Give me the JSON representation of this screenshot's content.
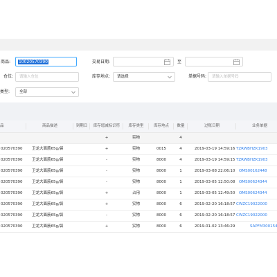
{
  "filters": {
    "product": {
      "label": "商品:",
      "value": "10020570390"
    },
    "txn_date": {
      "label": "交易日期:",
      "separator": "至",
      "start_icon": "calendar-icon",
      "end_icon": "calendar-icon"
    },
    "location": {
      "label": "仓位:",
      "placeholder": "请输入仓位"
    },
    "warehouse": {
      "label": "库存地点:",
      "placeholder": "请选择",
      "icon": "chevron-down-icon"
    },
    "doc_no": {
      "label": "单据号码:",
      "placeholder": "请输入单据号码"
    },
    "type": {
      "label": "类型:",
      "value": "全部",
      "icon": "chevron-down-icon"
    }
  },
  "table": {
    "columns": [
      "品",
      "商品描述",
      "到期日",
      "库存增减标识符",
      "库存类型",
      "库存地点",
      "数量",
      "过账日期",
      "业务单据"
    ],
    "subtotal": {
      "sign": "+",
      "type": "实物",
      "qty": "4"
    },
    "rows": [
      {
        "sku": "020570390",
        "desc": "卫龙大面筋65g/袋",
        "expiry": "",
        "sign": "+",
        "type": "实物",
        "location": "0015",
        "qty": "4",
        "date": "2019-03-19 14:59:16",
        "doc": "TZRWBHZK1903"
      },
      {
        "sku": "020570390",
        "desc": "卫龙大面筋65g/袋",
        "expiry": "",
        "sign": "-",
        "type": "实物",
        "location": "8000",
        "qty": "4",
        "date": "2019-03-19 14:59:15",
        "doc": "TZRWBHZK1903"
      },
      {
        "sku": "020570390",
        "desc": "卫龙大面筋65g/袋",
        "expiry": "",
        "sign": "-",
        "type": "实物",
        "location": "8000",
        "qty": "1",
        "date": "2019-03-08 22:06:10",
        "doc": "OMS00162448"
      },
      {
        "sku": "020570390",
        "desc": "卫龙大面筋65g/袋",
        "expiry": "",
        "sign": "-",
        "type": "实物",
        "location": "8000",
        "qty": "1",
        "date": "2019-03-05 12:50:08",
        "doc": "OMS00624344"
      },
      {
        "sku": "020570390",
        "desc": "卫龙大面筋65g/袋",
        "expiry": "",
        "sign": "+",
        "type": "占用",
        "location": "8000",
        "qty": "1",
        "date": "2019-03-05 12:49:50",
        "doc": "OMS00624344"
      },
      {
        "sku": "020570390",
        "desc": "卫龙大面筋65g/袋",
        "expiry": "",
        "sign": "+",
        "type": "实物",
        "location": "8000",
        "qty": "6",
        "date": "2019-02-20 16:18:57",
        "doc": "CWZC19022000"
      },
      {
        "sku": "020570390",
        "desc": "卫龙大面筋65g/袋",
        "expiry": "",
        "sign": "-",
        "type": "实物",
        "location": "8000",
        "qty": "6",
        "date": "2019-02-20 16:18:57",
        "doc": "CWZC19022000"
      },
      {
        "sku": "020570390",
        "desc": "卫龙大面筋65g/袋",
        "expiry": "",
        "sign": "+",
        "type": "实物",
        "location": "8000",
        "qty": "6",
        "date": "2019-01-02 13:46:29",
        "doc": "SAPFM300154"
      }
    ]
  },
  "colors": {
    "accent": "#40a9ff",
    "link": "#2f80ed",
    "selection": "#1e6fd9",
    "header_bg": "#f4f5f8"
  }
}
